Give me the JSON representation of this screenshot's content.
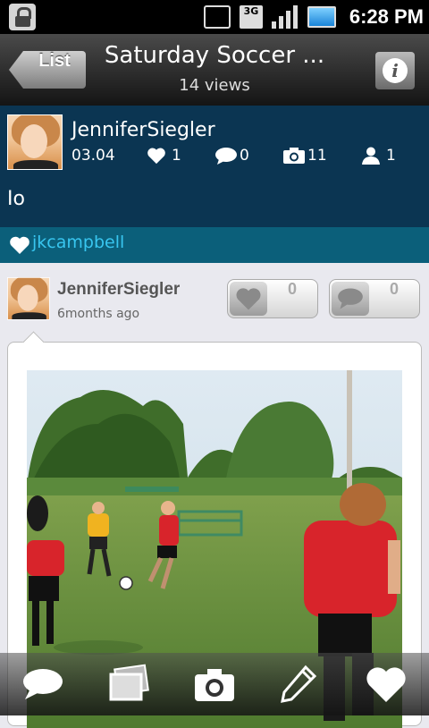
{
  "status_bar": {
    "time": "6:28 PM",
    "network": "3G"
  },
  "header": {
    "back_label": "List",
    "title": "Saturday Soccer ...",
    "subtitle": "14 views"
  },
  "post": {
    "author": "JenniferSiegler",
    "date": "03.04",
    "likes": "1",
    "comments": "0",
    "photos": "11",
    "members": "1",
    "body": "Io"
  },
  "liked_by": {
    "name": "jkcampbell"
  },
  "photo_post": {
    "author": "JenniferSiegler",
    "time": "6months ago",
    "like_count": "0",
    "comment_count": "0"
  },
  "toolbar": {
    "items": [
      "comment-icon",
      "gallery-icon",
      "camera-icon",
      "edit-icon",
      "heart-icon"
    ]
  },
  "colors": {
    "post_bg": "#0b3552",
    "likes_bg": "#0b5f7a",
    "link": "#38c6f0",
    "page_bg": "#e9e9ef"
  }
}
